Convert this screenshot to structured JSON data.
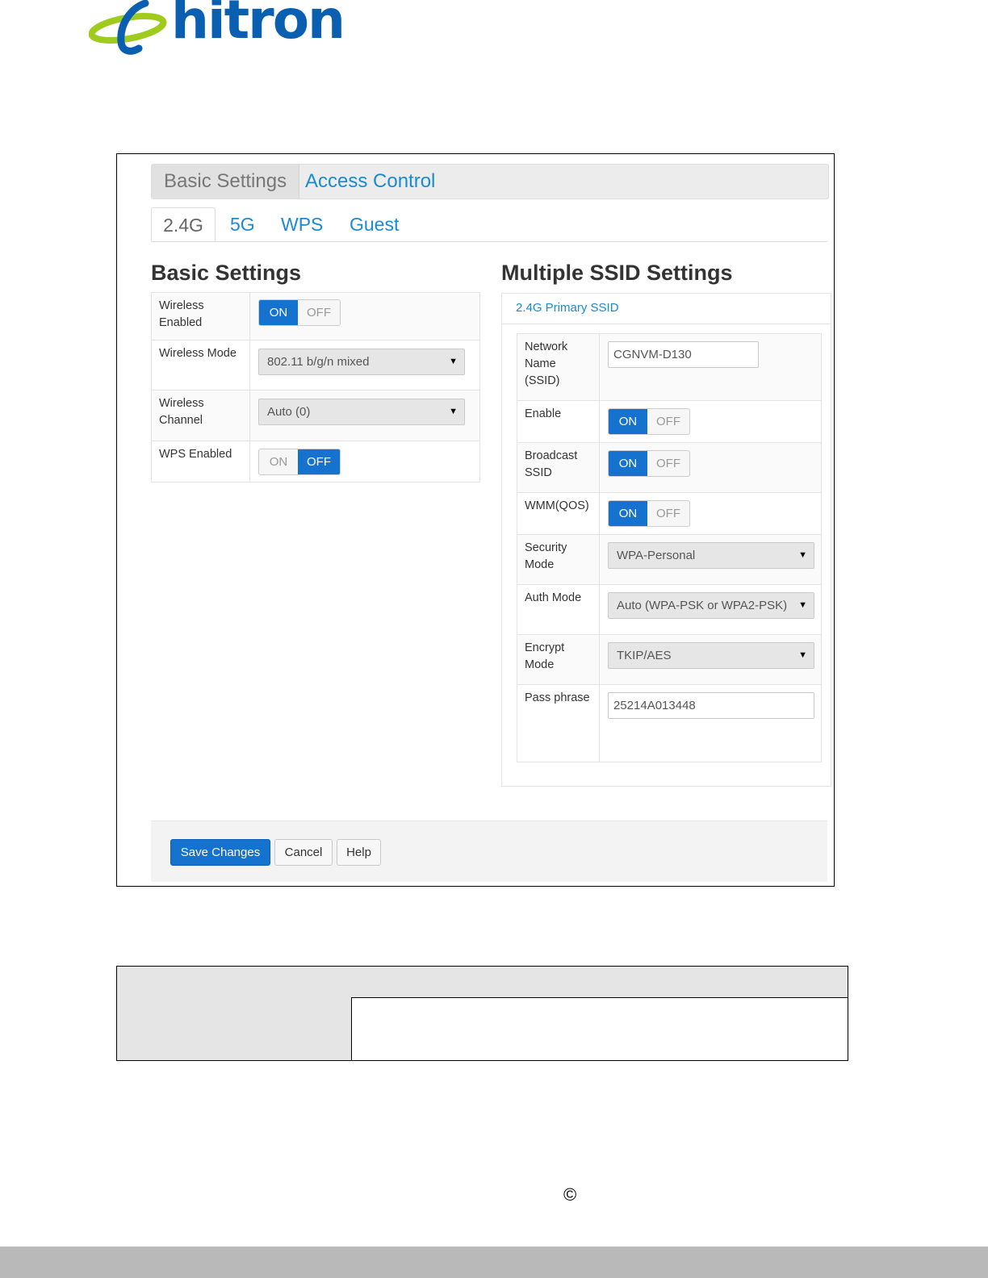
{
  "brand": {
    "name": "hitron"
  },
  "tabs_top": [
    {
      "label": "Basic Settings",
      "active": true
    },
    {
      "label": "Access Control",
      "active": false
    }
  ],
  "tabs_band": [
    {
      "label": "2.4G",
      "active": true
    },
    {
      "label": "5G"
    },
    {
      "label": "WPS"
    },
    {
      "label": "Guest"
    }
  ],
  "basic_settings": {
    "title": "Basic Settings",
    "wireless_enabled": {
      "label": "Wireless Enabled",
      "on": "ON",
      "off": "OFF",
      "value": "ON"
    },
    "wireless_mode": {
      "label": "Wireless Mode",
      "value": "802.11 b/g/n mixed"
    },
    "wireless_channel": {
      "label": "Wireless Channel",
      "value": "Auto (0)"
    },
    "wps_enabled": {
      "label": "WPS Enabled",
      "on": "ON",
      "off": "OFF",
      "value": "OFF"
    }
  },
  "ssid_settings": {
    "title": "Multiple SSID Settings",
    "panel_title": "2.4G Primary SSID",
    "network_name": {
      "label": "Network Name (SSID)",
      "value": "CGNVM-D130"
    },
    "enable": {
      "label": "Enable",
      "on": "ON",
      "off": "OFF",
      "value": "ON"
    },
    "broadcast_ssid": {
      "label": "Broadcast SSID",
      "on": "ON",
      "off": "OFF",
      "value": "ON"
    },
    "wmm": {
      "label": "WMM(QOS)",
      "on": "ON",
      "off": "OFF",
      "value": "ON"
    },
    "security_mode": {
      "label": "Security Mode",
      "value": "WPA-Personal"
    },
    "auth_mode": {
      "label": "Auth Mode",
      "value": "Auto (WPA-PSK or WPA2-PSK)"
    },
    "encrypt_mode": {
      "label": "Encrypt Mode",
      "value": "TKIP/AES"
    },
    "pass_phrase": {
      "label": "Pass phrase",
      "value": "25214A013448"
    }
  },
  "footer": {
    "save": "Save Changes",
    "cancel": "Cancel",
    "help": "Help"
  },
  "page_footer": {
    "copyright_symbol": "©"
  },
  "colors": {
    "accent": "#1672cf",
    "link": "#1a8ad3",
    "logo_blue": "#0b5fb0",
    "logo_green": "#9ecb1c"
  }
}
